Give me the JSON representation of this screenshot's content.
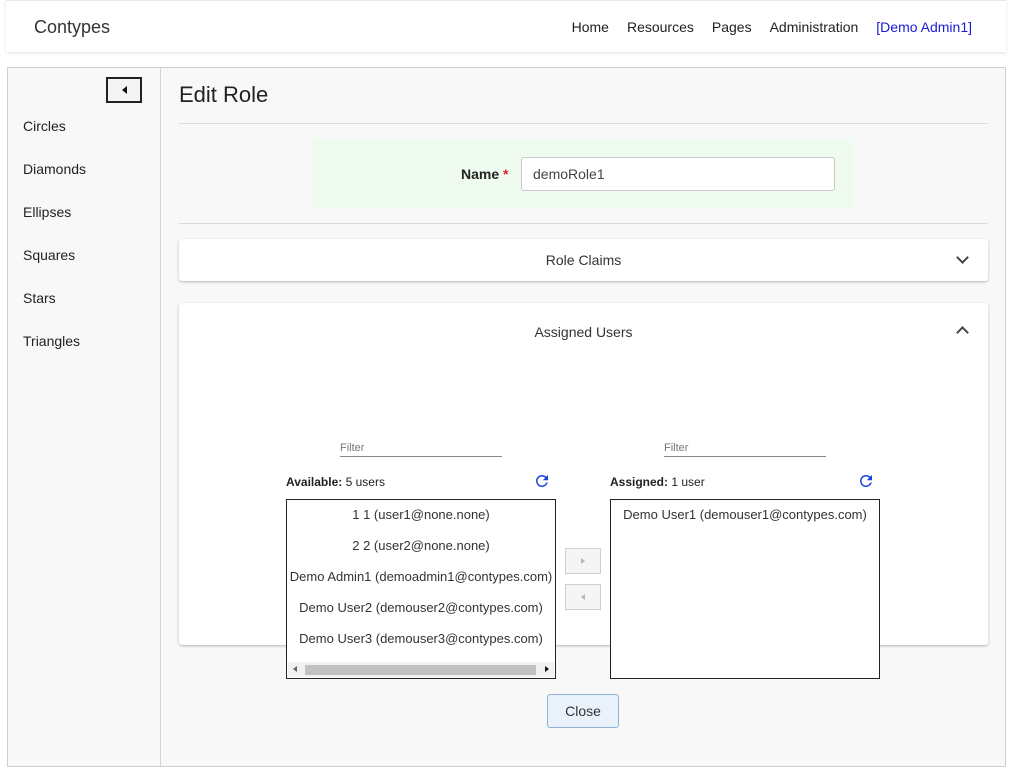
{
  "app": {
    "brand": "Contypes"
  },
  "nav": {
    "home": "Home",
    "resources": "Resources",
    "pages": "Pages",
    "administration": "Administration",
    "user": "[Demo Admin1]"
  },
  "sidebar": {
    "items": [
      {
        "label": "Circles"
      },
      {
        "label": "Diamonds"
      },
      {
        "label": "Ellipses"
      },
      {
        "label": "Squares"
      },
      {
        "label": "Stars"
      },
      {
        "label": "Triangles"
      }
    ]
  },
  "page": {
    "title": "Edit Role"
  },
  "form": {
    "name_label": "Name",
    "required_mark": "*",
    "name_value": "demoRole1"
  },
  "role_claims": {
    "title": "Role Claims"
  },
  "assigned_users": {
    "title": "Assigned Users",
    "available": {
      "filter_placeholder": "Filter",
      "label": "Available:",
      "count_text": "5 users",
      "items": [
        "1 1 (user1@none.none)",
        "2 2 (user2@none.none)",
        "Demo Admin1 (demoadmin1@contypes.com)",
        "Demo User2 (demouser2@contypes.com)",
        "Demo User3 (demouser3@contypes.com)"
      ]
    },
    "assigned": {
      "filter_placeholder": "Filter",
      "label": "Assigned:",
      "count_text": "1 user",
      "items": [
        "Demo User1 (demouser1@contypes.com)"
      ]
    }
  },
  "buttons": {
    "close": "Close"
  },
  "colors": {
    "accent_link": "#1a1adb",
    "refresh_icon": "#1a3fe0",
    "name_panel_bg": "#f0fbf0",
    "required": "#d9232e"
  }
}
